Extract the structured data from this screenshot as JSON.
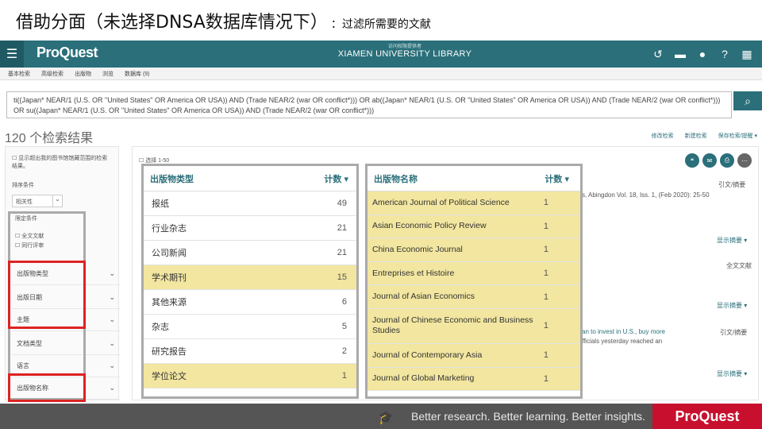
{
  "slide": {
    "title": "借助分面（未选择DNSA数据库情况下）",
    "subtitle": "：过滤所需要的文献"
  },
  "topbar": {
    "logo": "ProQuest",
    "library_small": "访问权限提供者",
    "library": "XIAMEN UNIVERSITY LIBRARY",
    "menu_icon": "☰",
    "icons": [
      "history-icon",
      "folder-icon",
      "user-icon",
      "help-icon",
      "grid-icon"
    ]
  },
  "subnav": [
    "基本检索",
    "高级检索",
    "出版物",
    "浏览",
    "数据库 (9)"
  ],
  "search": {
    "query": "ti((Japan* NEAR/1 (U.S. OR \"United States\" OR America OR USA)) AND (Trade NEAR/2 (war OR conflict*))) OR ab((Japan* NEAR/1 (U.S. OR \"United States\" OR America OR USA)) AND (Trade NEAR/2 (war OR conflict*))) OR su((Japan* NEAR/1 (U.S. OR \"United States\" OR America OR USA)) AND (Trade NEAR/2 (war OR conflict*)))",
    "button_icon": "🔍"
  },
  "results": {
    "count": "120 个检索结果",
    "links": [
      "修改检索",
      "新建检索",
      "保存检索/提醒 ▾"
    ],
    "select_page": "☐ 选择 1-50"
  },
  "left_panel": {
    "checkbox_text": "☐ 显示超出我的图书馆馆藏范围的检索结果。",
    "sort_label": "排序条件",
    "sort_value": "相关性",
    "recent_label": "限定条件",
    "fulltext": "☐ 全文文献",
    "peer": "☐ 同行评审",
    "filters": [
      "出版物类型",
      "出版日期",
      "主题",
      "文档类型",
      "语言",
      "出版物名称"
    ]
  },
  "background": {
    "snippet1": "s, Abingdon Vol. 18, Iss. 1, (Feb 2020): 25-50",
    "cite1": "引文/摘要",
    "show_abstract": "显示摘要 ▾",
    "fulltext_label": "全文文献",
    "snippet2a": "an to invest in U.S., buy more",
    "snippet2b": "fficials yesterday reached an",
    "cite2": "引文/摘要"
  },
  "pubtype_table": {
    "header_name": "出版物类型",
    "header_count": "计数 ▾",
    "rows": [
      {
        "name": "报纸",
        "count": "49",
        "highlight": false
      },
      {
        "name": "行业杂志",
        "count": "21",
        "highlight": false
      },
      {
        "name": "公司新闻",
        "count": "21",
        "highlight": false
      },
      {
        "name": "学术期刊",
        "count": "15",
        "highlight": true
      },
      {
        "name": "其他来源",
        "count": "6",
        "highlight": false
      },
      {
        "name": "杂志",
        "count": "5",
        "highlight": false
      },
      {
        "name": "研究报告",
        "count": "2",
        "highlight": false
      },
      {
        "name": "学位论文",
        "count": "1",
        "highlight": true
      }
    ]
  },
  "pubname_table": {
    "header_name": "出版物名称",
    "header_count": "计数 ▾",
    "rows": [
      {
        "name": "American Journal of Political Science",
        "count": "1"
      },
      {
        "name": "Asian Economic Policy Review",
        "count": "1"
      },
      {
        "name": "China Economic Journal",
        "count": "1"
      },
      {
        "name": "Entreprises et Histoire",
        "count": "1"
      },
      {
        "name": "Journal of Asian Economics",
        "count": "1"
      },
      {
        "name": "Journal of Chinese Economic and Business Studies",
        "count": "1"
      },
      {
        "name": "Journal of Contemporary Asia",
        "count": "1"
      },
      {
        "name": "Journal of Global Marketing",
        "count": "1"
      }
    ]
  },
  "footer": {
    "tagline": "Better research. Better learning. Better insights.",
    "brand": "ProQuest"
  },
  "colors": {
    "teal": "#2a6f7a",
    "highlight": "#f2e6a0",
    "red": "#dd2222",
    "brand_red": "#c8102e"
  }
}
